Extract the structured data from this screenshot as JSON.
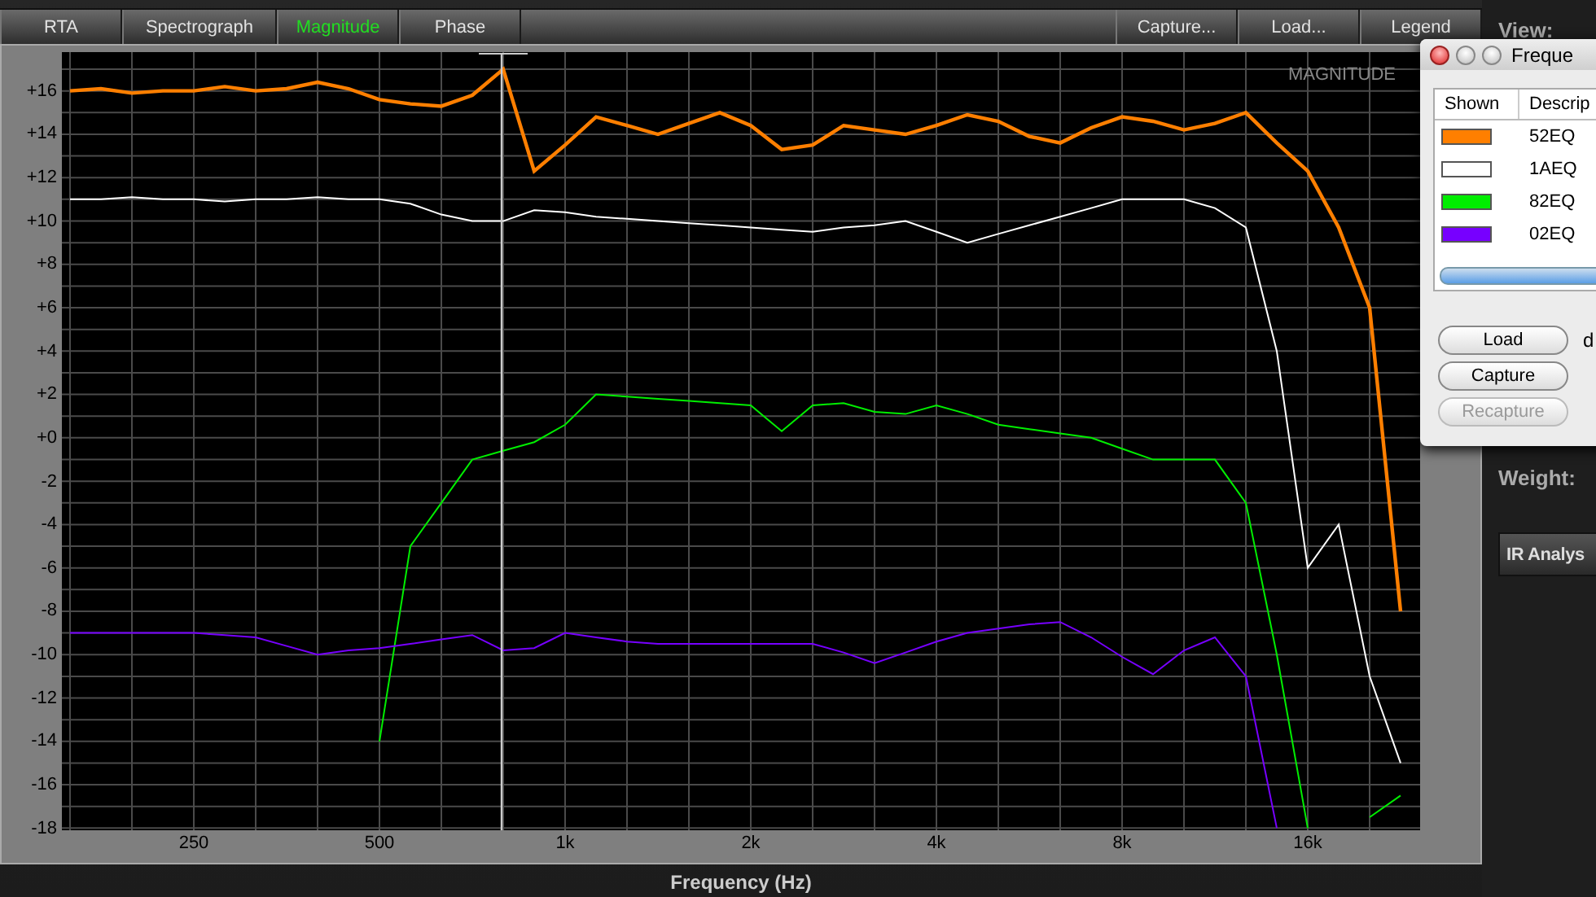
{
  "tabs": [
    {
      "label": "RTA",
      "selected": false
    },
    {
      "label": "Spectrograph",
      "selected": false
    },
    {
      "label": "Magnitude",
      "selected": true
    },
    {
      "label": "Phase",
      "selected": false
    }
  ],
  "toolbar_buttons": [
    "Capture...",
    "Load...",
    "Legend"
  ],
  "chart": {
    "chart_data": {
      "type": "line",
      "title": "MAGNITUDE",
      "xlabel": "Frequency (Hz)",
      "grid": true,
      "ylim": [
        -18.1,
        17.79
      ],
      "yticks": [
        {
          "value": 16,
          "label": "+16"
        },
        {
          "value": 14,
          "label": "+14"
        },
        {
          "value": 12,
          "label": "+12"
        },
        {
          "value": 10,
          "label": "+10"
        },
        {
          "value": 8,
          "label": "+8"
        },
        {
          "value": 6,
          "label": "+6"
        },
        {
          "value": 4,
          "label": "+4"
        },
        {
          "value": 2,
          "label": "+2"
        },
        {
          "value": 0,
          "label": "+0"
        },
        {
          "value": -2,
          "label": "-2"
        },
        {
          "value": -4,
          "label": "-4"
        },
        {
          "value": -6,
          "label": "-6"
        },
        {
          "value": -8,
          "label": "-8"
        },
        {
          "value": -10,
          "label": "-10"
        },
        {
          "value": -12,
          "label": "-12"
        },
        {
          "value": -14,
          "label": "-14"
        },
        {
          "value": -16,
          "label": "-16"
        },
        {
          "value": -18,
          "label": "-18"
        }
      ],
      "categories": [
        null,
        null,
        null,
        null,
        "250",
        null,
        null,
        null,
        null,
        null,
        "500",
        null,
        null,
        null,
        null,
        null,
        "1k",
        null,
        null,
        null,
        null,
        null,
        "2k",
        null,
        null,
        null,
        null,
        null,
        "4k",
        null,
        null,
        null,
        null,
        null,
        "8k",
        null,
        null,
        null,
        null,
        null,
        "16k",
        null,
        null,
        null
      ],
      "series": [
        {
          "color": "#ff7f00",
          "values": [
            16,
            16.1,
            15.9,
            16,
            16,
            16.2,
            16,
            16.1,
            16.4,
            16.1,
            15.6,
            15.4,
            15.3,
            15.8,
            17,
            12.3,
            13.5,
            14.8,
            14.4,
            14,
            14.5,
            15,
            14.4,
            13.3,
            13.5,
            14.4,
            14.2,
            14,
            14.4,
            14.9,
            14.6,
            13.9,
            13.6,
            14.3,
            14.8,
            14.6,
            14.2,
            14.5,
            15,
            13.6,
            12.3,
            9.7,
            6,
            -8
          ]
        },
        {
          "color": "#ffffff",
          "values": [
            11,
            11,
            11.1,
            11,
            11,
            10.9,
            11,
            11,
            11.1,
            11,
            11,
            10.8,
            10.3,
            10,
            10,
            10.5,
            10.4,
            10.2,
            10.1,
            10,
            9.9,
            9.8,
            9.7,
            9.6,
            9.5,
            9.7,
            9.8,
            10,
            9.5,
            9,
            9.4,
            9.8,
            10.2,
            10.6,
            11,
            11,
            11,
            10.6,
            9.7,
            4,
            -6,
            -4,
            -11,
            -15
          ]
        },
        {
          "color": "#00ee00",
          "values": [
            null,
            null,
            null,
            null,
            null,
            null,
            null,
            null,
            null,
            null,
            -14,
            -5,
            -3,
            -1,
            -0.6,
            -0.2,
            0.6,
            2,
            1.9,
            1.8,
            1.7,
            1.6,
            1.5,
            0.3,
            1.5,
            1.6,
            1.2,
            1.1,
            1.5,
            1.1,
            0.6,
            0.4,
            0.2,
            0,
            -0.5,
            -1,
            -1,
            -1,
            -3,
            -10,
            -18,
            null,
            -17.5,
            -16.5
          ]
        },
        {
          "color": "#7700ff",
          "values": [
            -9,
            -9,
            -9,
            -9,
            -9,
            -9.1,
            -9.2,
            -9.6,
            -10,
            -9.8,
            -9.7,
            -9.5,
            -9.3,
            -9.1,
            -9.8,
            -9.7,
            -9,
            -9.2,
            -9.4,
            -9.5,
            -9.5,
            -9.5,
            -9.5,
            -9.5,
            -9.5,
            -9.9,
            -10.4,
            -9.9,
            -9.4,
            -9,
            -8.8,
            -8.6,
            -8.5,
            -9.2,
            -10.1,
            -10.9,
            -9.8,
            -9.2,
            -11,
            -18,
            null,
            null,
            null,
            null
          ]
        }
      ]
    }
  },
  "side_panel": {
    "view_label": "View:",
    "weight_label": "Weight:",
    "ir_button": "IR Analys"
  },
  "legend_window": {
    "title": "Freque",
    "columns": [
      "Shown",
      "Descrip"
    ],
    "rows": [
      {
        "color": "#ff7f00",
        "description": "52EQ"
      },
      {
        "color": "#ffffff",
        "description": "1AEQ"
      },
      {
        "color": "#00ee00",
        "description": "82EQ"
      },
      {
        "color": "#7700ff",
        "description": "02EQ"
      }
    ],
    "buttons": [
      {
        "label": "Load",
        "disabled": false
      },
      {
        "label": "Capture",
        "disabled": false
      },
      {
        "label": "Recapture",
        "disabled": true
      }
    ],
    "side_text": "d"
  }
}
